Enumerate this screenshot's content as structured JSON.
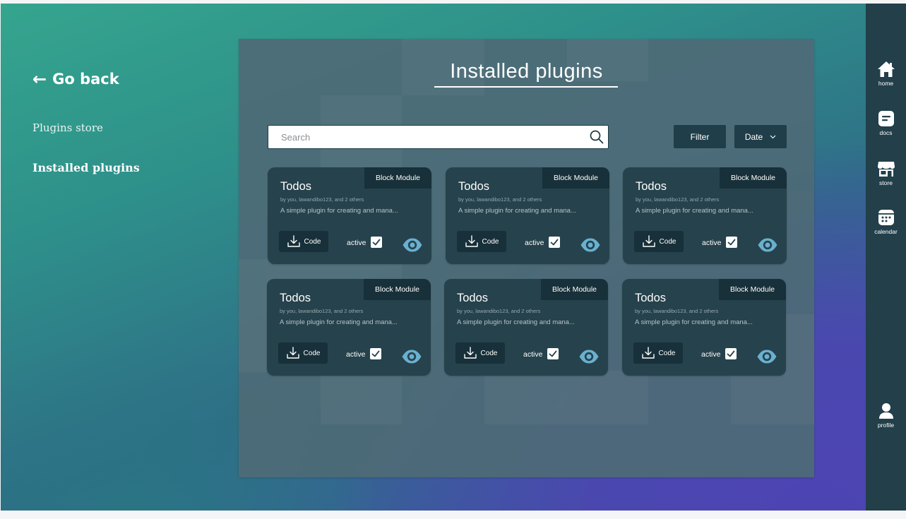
{
  "left_nav": {
    "back_label": "Go back",
    "items": [
      {
        "label": "Plugins store",
        "active": false
      },
      {
        "label": "Installed plugins",
        "active": true
      }
    ]
  },
  "main": {
    "title": "Installed plugins",
    "search": {
      "placeholder": "Search",
      "value": ""
    },
    "filter_label": "Filter",
    "sort": {
      "selected": "Date"
    }
  },
  "plugins": [
    {
      "badge": "Block Module",
      "name": "Todos",
      "authors": "by you, lawandibo123, and 2 others",
      "description": "A simple plugin for creating and mana...",
      "code_label": "Code",
      "status_label": "active",
      "active": true
    },
    {
      "badge": "Block Module",
      "name": "Todos",
      "authors": "by you, lawandibo123, and 2 others",
      "description": "A simple plugin for creating and mana...",
      "code_label": "Code",
      "status_label": "active",
      "active": true
    },
    {
      "badge": "Block Module",
      "name": "Todos",
      "authors": "by you, lawandibo123, and 2 others",
      "description": "A simple plugin for creating and mana...",
      "code_label": "Code",
      "status_label": "active",
      "active": true
    },
    {
      "badge": "Block Module",
      "name": "Todos",
      "authors": "by you, lawandibo123, and 2 others",
      "description": "A simple plugin for creating and mana...",
      "code_label": "Code",
      "status_label": "active",
      "active": true
    },
    {
      "badge": "Block Module",
      "name": "Todos",
      "authors": "by you, lawandibo123, and 2 others",
      "description": "A simple plugin for creating and mana...",
      "code_label": "Code",
      "status_label": "active",
      "active": true
    },
    {
      "badge": "Block Module",
      "name": "Todos",
      "authors": "by you, lawandibo123, and 2 others",
      "description": "A simple plugin for creating and mana...",
      "code_label": "Code",
      "status_label": "active",
      "active": true
    }
  ],
  "right_rail": {
    "items": [
      {
        "icon": "home-icon",
        "label": "home"
      },
      {
        "icon": "docs-icon",
        "label": "docs"
      },
      {
        "icon": "store-icon",
        "label": "store"
      },
      {
        "icon": "calendar-icon",
        "label": "calendar"
      },
      {
        "icon": "profile-icon",
        "label": "profile"
      }
    ]
  },
  "colors": {
    "gradient_start": "#35a58e",
    "gradient_end": "#4d44b3",
    "panel": "#4e6b76",
    "card": "#26424c",
    "rail": "#223f4a",
    "eye_icon": "#6ab0d0"
  }
}
